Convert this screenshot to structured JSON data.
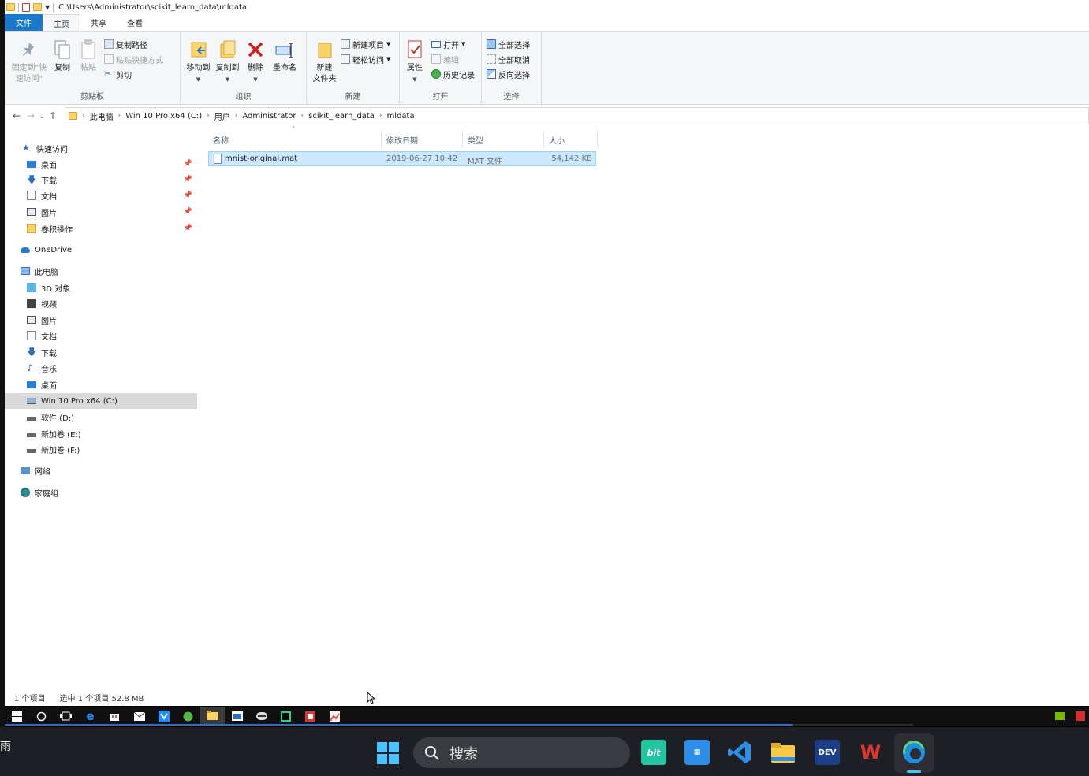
{
  "title_path": "C:\\Users\\Administrator\\scikit_learn_data\\mldata",
  "tabs": [
    "文件",
    "主页",
    "共享",
    "查看"
  ],
  "ribbon": {
    "clipboard": {
      "label": "剪贴板",
      "pin_label_1": "固定到\"快",
      "pin_label_2": "速访问\"",
      "copy": "复制",
      "paste": "粘贴",
      "copy_path": "复制路径",
      "paste_shortcut": "粘贴快捷方式",
      "cut": "剪切"
    },
    "organize": {
      "label": "组织",
      "move_to": "移动到",
      "copy_to": "复制到",
      "delete": "删除",
      "rename": "重命名"
    },
    "new": {
      "label": "新建",
      "new_folder_1": "新建",
      "new_folder_2": "文件夹",
      "new_item": "新建项目",
      "easy_access": "轻松访问"
    },
    "open": {
      "label": "打开",
      "properties": "属性",
      "open": "打开",
      "edit": "编辑",
      "history": "历史记录"
    },
    "select": {
      "label": "选择",
      "select_all": "全部选择",
      "select_none": "全部取消",
      "invert": "反向选择"
    }
  },
  "breadcrumb": [
    "此电脑",
    "Win 10 Pro x64 (C:)",
    "用户",
    "Administrator",
    "scikit_learn_data",
    "mldata"
  ],
  "nav": {
    "quick_access": "快速访问",
    "qa_items": [
      "桌面",
      "下载",
      "文档",
      "图片",
      "卷积操作"
    ],
    "onedrive": "OneDrive",
    "this_pc": "此电脑",
    "pc_items": [
      "3D 对象",
      "视频",
      "图片",
      "文档",
      "下载",
      "音乐",
      "桌面",
      "Win 10 Pro x64 (C:)",
      "软件 (D:)",
      "新加卷 (E:)",
      "新加卷 (F:)"
    ],
    "network": "网络",
    "homegroup": "家庭组"
  },
  "columns": {
    "name": "名称",
    "date": "修改日期",
    "type": "类型",
    "size": "大小"
  },
  "files": [
    {
      "name": "mnist-original.mat",
      "date": "2019-06-27 10:42",
      "type": "MAT 文件",
      "size": "54,142 KB"
    }
  ],
  "status": {
    "count": "1 个项目",
    "selected": "选中 1 个项目  52.8 MB"
  },
  "outer_taskbar": {
    "weather": "雨",
    "search_placeholder": "搜索"
  },
  "taskbar_icons": [
    "bit-icon",
    "youdao-icon",
    "vscode-icon",
    "file-explorer-icon",
    "devcpp-icon",
    "wps-icon",
    "edge-icon"
  ]
}
